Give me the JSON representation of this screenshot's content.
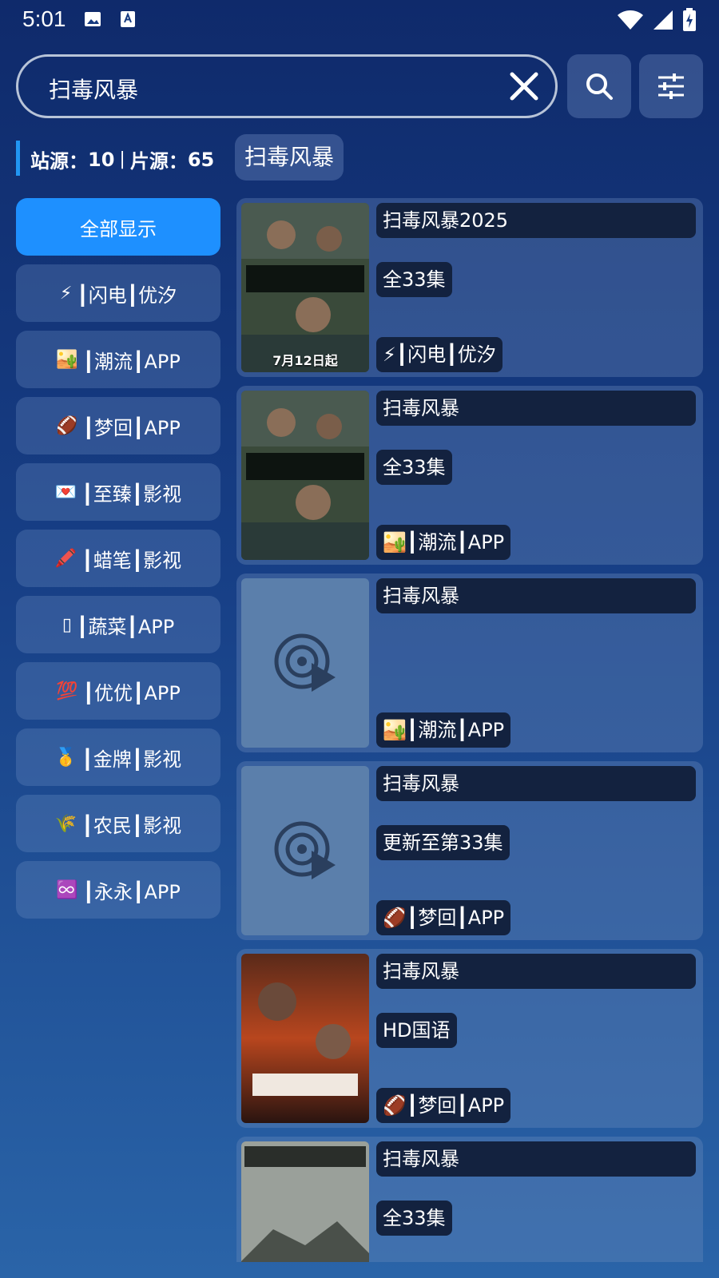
{
  "status_bar": {
    "time": "5:01"
  },
  "search": {
    "query": "扫毒风暴",
    "clear_icon": "close-icon",
    "search_icon": "search-icon",
    "filter_icon": "tune-icon"
  },
  "stats": {
    "site_label": "站源：",
    "site_count": "10",
    "separator": "|",
    "film_label": "片源：",
    "film_count": "65"
  },
  "keyword_chip": "扫毒风暴",
  "sidebar": {
    "items": [
      {
        "label": "全部显示",
        "active": true
      },
      {
        "emoji": "⚡",
        "label": "┃闪电┃优汐"
      },
      {
        "emoji": "🏜️",
        "label": "┃潮流┃APP"
      },
      {
        "emoji": "🏈",
        "label": "┃梦回┃APP"
      },
      {
        "emoji": "💌",
        "label": "┃至臻┃影视"
      },
      {
        "emoji": "🖍️",
        "label": "┃蜡笔┃影视"
      },
      {
        "emoji": "▯",
        "label": "┃蔬菜┃APP"
      },
      {
        "emoji": "💯",
        "label": "┃优优┃APP"
      },
      {
        "emoji": "🥇",
        "label": "┃金牌┃影视"
      },
      {
        "emoji": "🌾",
        "label": "┃农民┃影视"
      },
      {
        "emoji": "♾️",
        "label": "┃永永┃APP"
      }
    ]
  },
  "results": [
    {
      "title": "扫毒风暴2025",
      "episode": "全33集",
      "source": "⚡┃闪电┃优汐",
      "poster": "poster-a",
      "poster_caption": "7月12日起"
    },
    {
      "title": "扫毒风暴",
      "episode": "全33集",
      "source": "🏜️┃潮流┃APP",
      "poster": "poster-a",
      "poster_caption": ""
    },
    {
      "title": "扫毒风暴",
      "episode": "",
      "source": "🏜️┃潮流┃APP",
      "poster": "placeholder",
      "poster_caption": ""
    },
    {
      "title": "扫毒风暴",
      "episode": "更新至第33集",
      "source": "🏈┃梦回┃APP",
      "poster": "placeholder",
      "poster_caption": ""
    },
    {
      "title": "扫毒风暴",
      "episode": "HD国语",
      "source": "🏈┃梦回┃APP",
      "poster": "poster-b",
      "poster_caption": ""
    },
    {
      "title": "扫毒风暴",
      "episode": "全33集",
      "source": "",
      "poster": "poster-c",
      "poster_caption": ""
    }
  ],
  "colors": {
    "accent": "#1e90ff",
    "card_label_bg": "#13223f",
    "placeholder_bg": "#5b7fab"
  }
}
